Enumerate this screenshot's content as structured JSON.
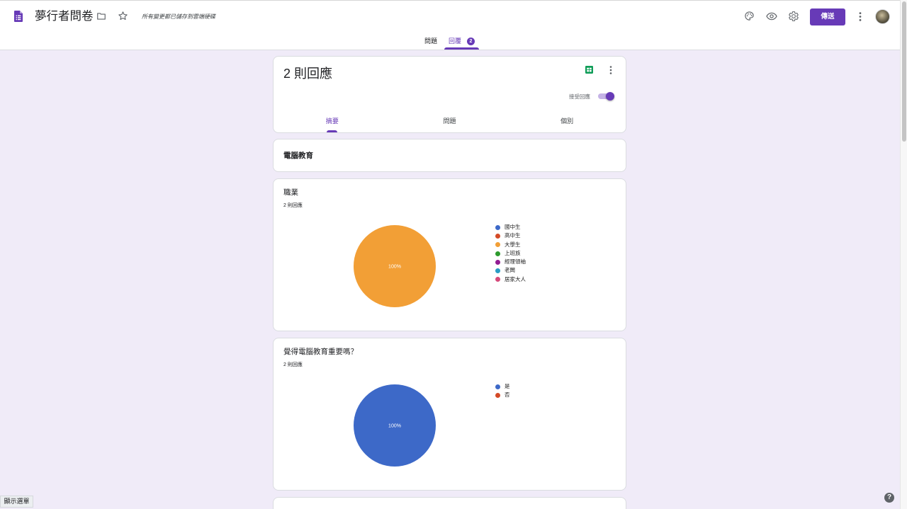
{
  "header": {
    "title": "夢行者問卷",
    "save_status": "所有變更都已儲存到雲端硬碟",
    "send_label": "傳送",
    "icons": {
      "app": "forms-icon",
      "move": "folder-icon",
      "favorite": "star-icon",
      "theme": "palette-icon",
      "preview": "eye-icon",
      "settings": "gear-icon",
      "more": "more-vert-icon"
    }
  },
  "top_tabs": [
    {
      "label": "問題",
      "active": false
    },
    {
      "label": "回覆",
      "badge": "2",
      "active": true
    }
  ],
  "responses_card": {
    "count": "2 則回應",
    "accepting_label": "接受回應",
    "accepting": true,
    "tabs": [
      {
        "label": "摘要",
        "active": true
      },
      {
        "label": "問題",
        "active": false
      },
      {
        "label": "個別",
        "active": false
      }
    ]
  },
  "section": {
    "title": "電腦教育"
  },
  "questions": [
    {
      "response_count": "2 則回應"
    },
    {
      "response_count": "2 則回應"
    }
  ],
  "chart_data": [
    {
      "type": "pie",
      "title": "職業",
      "categories": [
        "國中生",
        "高中生",
        "大學生",
        "上班族",
        "經理領袖",
        "老闆",
        "居家大人"
      ],
      "values": [
        0,
        0,
        100,
        0,
        0,
        0,
        0
      ],
      "colors": [
        "#3d69c8",
        "#d44a27",
        "#f29f36",
        "#2d9a2d",
        "#921c92",
        "#2a9cc4",
        "#d6497a"
      ],
      "legend": "right"
    },
    {
      "type": "pie",
      "title": "覺得電腦教育重要嗎？",
      "categories": [
        "是",
        "否"
      ],
      "values": [
        100,
        0
      ],
      "colors": [
        "#3d69c8",
        "#d44a27"
      ],
      "legend": "right"
    }
  ],
  "footer": {
    "menu_label": "顯示選單",
    "help_label": "?"
  },
  "colors": {
    "accent": "#673ab7",
    "accent_light": "#c5b3e6",
    "background": "#f0ebf8",
    "sheets_green": "#0f9d58",
    "icon_gray": "#5f6368"
  }
}
